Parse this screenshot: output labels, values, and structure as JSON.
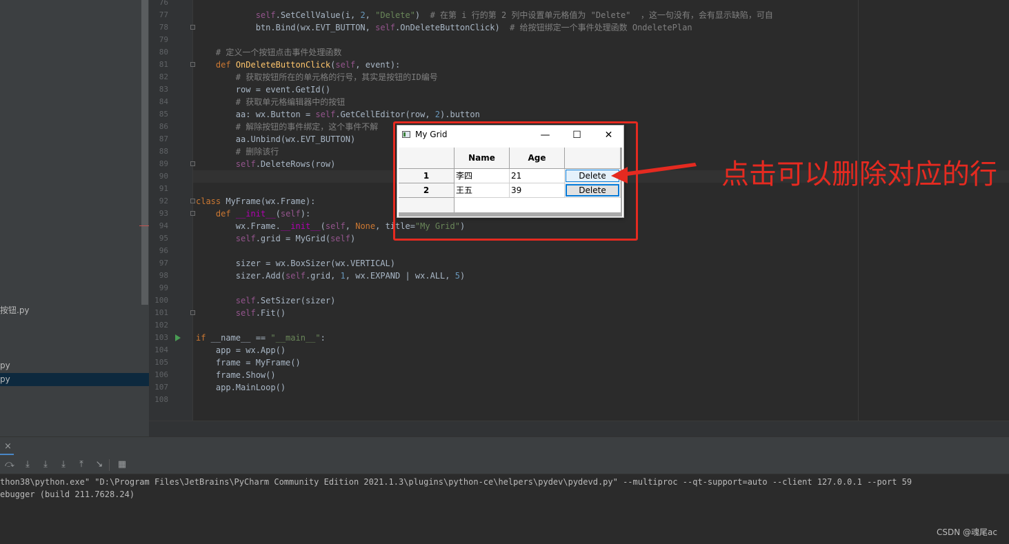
{
  "sidebar": {
    "files": [
      {
        "label": "按钮.py",
        "selected": false
      },
      {
        "label": "py",
        "selected": false
      },
      {
        "label": "py",
        "selected": true
      }
    ]
  },
  "editor": {
    "lines": [
      {
        "n": "76",
        "html": ""
      },
      {
        "n": "77",
        "html": "            <span class=\"self\">self</span>.SetCellValue(i, <span class=\"num\">2</span>, <span class=\"str\">\"Delete\"</span>)  <span class=\"cm\"># 在第 i 行的第 2 列中设置单元格值为 \"Delete\"  ，这一句没有，会有显示缺陷，可自</span>"
      },
      {
        "n": "78",
        "html": "            btn.Bind(wx.EVT_BUTTON, <span class=\"self\">self</span>.OnDeleteButtonClick)  <span class=\"cm\"># 给按钮绑定一个事件处理函数 OndeletePlan</span>"
      },
      {
        "n": "79",
        "html": ""
      },
      {
        "n": "80",
        "html": "    <span class=\"cm\"># 定义一个按钮点击事件处理函数</span>"
      },
      {
        "n": "81",
        "html": "    <span class=\"kw\">def</span> <span class=\"fn\">OnDeleteButtonClick</span>(<span class=\"self\">self</span>, event):"
      },
      {
        "n": "82",
        "html": "        <span class=\"cm\"># 获取按钮所在的单元格的行号，其实是按钮的ID编号</span>"
      },
      {
        "n": "83",
        "html": "        row = event.GetId()"
      },
      {
        "n": "84",
        "html": "        <span class=\"cm\"># 获取单元格编辑器中的按钮</span>"
      },
      {
        "n": "85",
        "html": "        aa: wx.Button = <span class=\"self\">self</span>.GetCellEditor(row, <span class=\"num\">2</span>).button"
      },
      {
        "n": "86",
        "html": "        <span class=\"cm\"># 解除按钮的事件绑定，这个事件不解</span>"
      },
      {
        "n": "87",
        "html": "        aa.Unbind(wx.EVT_BUTTON)"
      },
      {
        "n": "88",
        "html": "        <span class=\"cm\"># 删除该行</span>"
      },
      {
        "n": "89",
        "html": "        <span class=\"self\">self</span>.DeleteRows(row)"
      },
      {
        "n": "90",
        "html": ""
      },
      {
        "n": "91",
        "html": ""
      },
      {
        "n": "92",
        "html": "<span class=\"kw\">class</span> MyFrame(wx.Frame):"
      },
      {
        "n": "93",
        "html": "    <span class=\"kw\">def</span> <span class=\"magic\">__init__</span>(<span class=\"self\">self</span>):"
      },
      {
        "n": "94",
        "html": "        wx.Frame.<span class=\"magic\">__init__</span>(<span class=\"self\">self</span>, <span class=\"kw\">None</span>, title=<span class=\"str\">\"My Grid\"</span>)"
      },
      {
        "n": "95",
        "html": "        <span class=\"self\">self</span>.grid = MyGrid(<span class=\"self\">self</span>)"
      },
      {
        "n": "96",
        "html": ""
      },
      {
        "n": "97",
        "html": "        sizer = wx.BoxSizer(wx.VERTICAL)"
      },
      {
        "n": "98",
        "html": "        sizer.Add(<span class=\"self\">self</span>.grid, <span class=\"num\">1</span>, wx.EXPAND | wx.ALL, <span class=\"num\">5</span>)"
      },
      {
        "n": "99",
        "html": ""
      },
      {
        "n": "100",
        "html": "        <span class=\"self\">self</span>.SetSizer(sizer)"
      },
      {
        "n": "101",
        "html": "        <span class=\"self\">self</span>.Fit()"
      },
      {
        "n": "102",
        "html": ""
      },
      {
        "n": "103",
        "html": "<span class=\"kw\">if</span> __name__ == <span class=\"str\">\"__main__\"</span>:"
      },
      {
        "n": "104",
        "html": "    app = wx.App()"
      },
      {
        "n": "105",
        "html": "    frame = MyFrame()"
      },
      {
        "n": "106",
        "html": "    frame.Show()"
      },
      {
        "n": "107",
        "html": "    app.MainLoop()"
      },
      {
        "n": "108",
        "html": ""
      }
    ]
  },
  "console": {
    "lines": [
      "thon38\\python.exe\" \"D:\\Program Files\\JetBrains\\PyCharm Community Edition 2021.1.3\\plugins\\python-ce\\helpers\\pydev\\pydevd.py\" --multiproc --qt-support=auto --client 127.0.0.1 --port 59",
      "ebugger (build 211.7628.24)"
    ],
    "close_label": "×"
  },
  "window": {
    "title": "My Grid",
    "minimize_label": "—",
    "maximize_label": "☐",
    "close_label": "✕",
    "grid": {
      "columns": [
        "Name",
        "Age",
        ""
      ],
      "rows": [
        {
          "label": "1",
          "name": "李四",
          "age": "21",
          "button": "Delete"
        },
        {
          "label": "2",
          "name": "王五",
          "age": "39",
          "button": "Delete"
        }
      ]
    }
  },
  "annotation": {
    "text": "点击可以删除对应的行",
    "color": "#e52a20"
  },
  "watermark": "CSDN @魂尾ac"
}
